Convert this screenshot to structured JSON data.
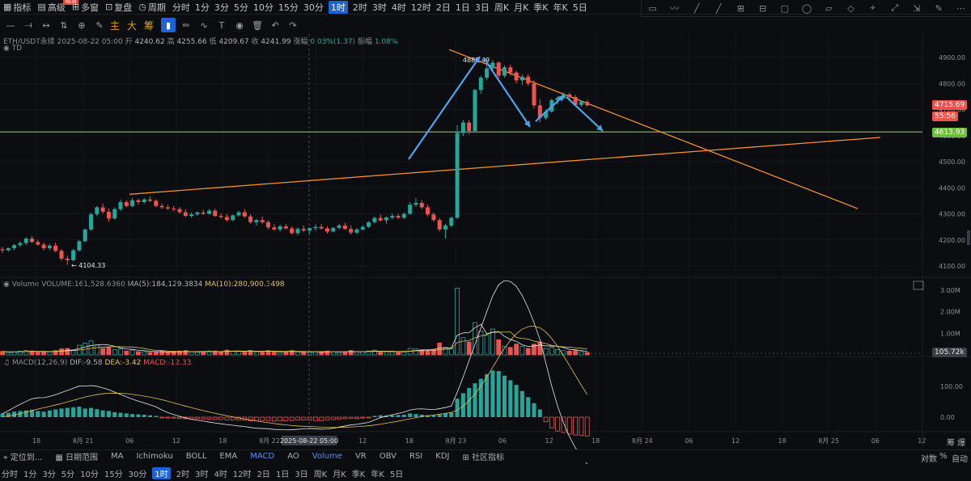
{
  "topbar": {
    "items": [
      {
        "icon": "indicator-icon",
        "label": "指标"
      },
      {
        "icon": "advanced-icon",
        "label": "高级"
      },
      {
        "icon": "multi-window-icon",
        "label": "多窗"
      },
      {
        "icon": "replay-icon",
        "label": "复盘"
      },
      {
        "icon": "period-icon",
        "label": "周期"
      }
    ],
    "badge": "NEW",
    "periods": [
      "分时",
      "1分",
      "3分",
      "5分",
      "10分",
      "15分",
      "30分",
      "1时",
      "2时",
      "3时",
      "4时",
      "12时",
      "2日",
      "1日",
      "3日",
      "周K",
      "月K",
      "季K",
      "年K",
      "5日"
    ],
    "active_period": "1时"
  },
  "toolbar": {
    "tools_left": [
      "minus",
      "line-h",
      "arrows",
      "sliders",
      "plus-box",
      "pen"
    ],
    "words": [
      "主",
      "大",
      "筹"
    ],
    "tools_right": [
      "bookmark",
      "pencil",
      "curve",
      "text",
      "eye",
      "trash",
      "undo",
      "redo"
    ]
  },
  "right_tools": [
    "▭",
    "〰",
    "╱",
    "╱",
    "⊞",
    "⊟",
    "▢",
    "◯",
    "▱",
    "◇",
    "⌖",
    "⤢",
    "⇲",
    "✎",
    "⋯"
  ],
  "header": {
    "symbol": "ETH/USDT永续",
    "time": "2025-08-22 05:00",
    "open_label": "开",
    "open": "4240.62",
    "high_label": "高",
    "high": "4255.66",
    "low_label": "低",
    "low": "4209.67",
    "close_label": "收",
    "close": "4241.99",
    "change_label": "涨幅",
    "change": "0.03%(1.37)",
    "amp_label": "振幅",
    "amp": "1.08%",
    "td": "TD"
  },
  "volume_info": {
    "label": "Volume",
    "vol": "VOLUME:161,528.6360",
    "ma5": "MA(5):184,129.3834",
    "ma10": "MA(10):280,900.3498"
  },
  "macd_info": {
    "label": "MACD(12,26,9)",
    "dif": "DIF:-9.58",
    "dea": "DEA:-3.42",
    "macd": "MACD:-12.33"
  },
  "colors": {
    "up": "#26a69a",
    "down": "#ef5350",
    "trend": "#f0922c",
    "support": "#6cbf3c",
    "arrow": "#4ea3f0"
  },
  "chart_data": {
    "type": "candlestick",
    "price_axis": {
      "ticks": [
        4100,
        4200,
        4300,
        4400,
        4500,
        4600,
        4700,
        4800,
        4900
      ],
      "labels": [
        "4100.00",
        "4200.00",
        "4300.00",
        "4400.00",
        "4500.00",
        "4600.00",
        "4700.00",
        "4800.00",
        "4900.00"
      ]
    },
    "volume_axis": {
      "labels": [
        "1.00M",
        "2.00M",
        "3.00M"
      ]
    },
    "macd_axis": {
      "labels": [
        "0.00",
        "100.00"
      ]
    },
    "time_axis": [
      "18",
      "8月 21",
      "06",
      "12",
      "18",
      "8月 22",
      "06",
      "12",
      "18",
      "8月 23",
      "06",
      "12",
      "18",
      "8月 24",
      "06",
      "12",
      "18",
      "8月 25",
      "06",
      "12"
    ],
    "crosshair_time": "2025-08-22 05:00",
    "annotations": {
      "high": "4888.49",
      "low": "4104.33"
    },
    "price_labels": {
      "last": "4715.69",
      "countdown": "55:56",
      "support": "4613.93",
      "volume": "105.72k"
    },
    "candles": [
      [
        4164,
        4173,
        4150,
        4160
      ],
      [
        4160,
        4170,
        4155,
        4168
      ],
      [
        4168,
        4185,
        4160,
        4180
      ],
      [
        4180,
        4195,
        4172,
        4188
      ],
      [
        4188,
        4210,
        4180,
        4205
      ],
      [
        4205,
        4215,
        4188,
        4192
      ],
      [
        4192,
        4200,
        4178,
        4182
      ],
      [
        4182,
        4190,
        4160,
        4168
      ],
      [
        4168,
        4185,
        4160,
        4178
      ],
      [
        4178,
        4190,
        4152,
        4158
      ],
      [
        4158,
        4165,
        4120,
        4128
      ],
      [
        4128,
        4140,
        4104,
        4122
      ],
      [
        4122,
        4165,
        4118,
        4160
      ],
      [
        4160,
        4200,
        4155,
        4195
      ],
      [
        4195,
        4245,
        4190,
        4240
      ],
      [
        4240,
        4305,
        4235,
        4298
      ],
      [
        4298,
        4330,
        4290,
        4325
      ],
      [
        4325,
        4340,
        4300,
        4308
      ],
      [
        4308,
        4320,
        4270,
        4282
      ],
      [
        4282,
        4325,
        4278,
        4318
      ],
      [
        4318,
        4355,
        4310,
        4345
      ],
      [
        4345,
        4352,
        4325,
        4330
      ],
      [
        4330,
        4362,
        4325,
        4352
      ],
      [
        4352,
        4358,
        4335,
        4345
      ],
      [
        4345,
        4360,
        4338,
        4355
      ],
      [
        4355,
        4368,
        4345,
        4350
      ],
      [
        4350,
        4356,
        4325,
        4330
      ],
      [
        4330,
        4340,
        4318,
        4325
      ],
      [
        4325,
        4335,
        4315,
        4320
      ],
      [
        4320,
        4330,
        4310,
        4318
      ],
      [
        4318,
        4326,
        4300,
        4306
      ],
      [
        4306,
        4318,
        4288,
        4292
      ],
      [
        4292,
        4306,
        4285,
        4298
      ],
      [
        4298,
        4310,
        4292,
        4305
      ],
      [
        4305,
        4316,
        4296,
        4300
      ],
      [
        4300,
        4318,
        4298,
        4312
      ],
      [
        4312,
        4320,
        4288,
        4292
      ],
      [
        4292,
        4302,
        4282,
        4288
      ],
      [
        4288,
        4300,
        4270,
        4276
      ],
      [
        4276,
        4298,
        4272,
        4294
      ],
      [
        4294,
        4312,
        4290,
        4306
      ],
      [
        4306,
        4318,
        4285,
        4290
      ],
      [
        4290,
        4298,
        4262,
        4268
      ],
      [
        4268,
        4282,
        4255,
        4276
      ],
      [
        4276,
        4290,
        4262,
        4268
      ],
      [
        4268,
        4275,
        4240,
        4248
      ],
      [
        4248,
        4260,
        4235,
        4240
      ],
      [
        4240,
        4258,
        4232,
        4252
      ],
      [
        4252,
        4262,
        4240,
        4244
      ],
      [
        4244,
        4252,
        4220,
        4226
      ],
      [
        4226,
        4248,
        4218,
        4242
      ],
      [
        4242,
        4255,
        4230,
        4236
      ],
      [
        4236,
        4248,
        4222,
        4245
      ],
      [
        4245,
        4260,
        4235,
        4250
      ],
      [
        4250,
        4262,
        4240,
        4244
      ],
      [
        4244,
        4252,
        4225,
        4232
      ],
      [
        4232,
        4250,
        4228,
        4246
      ],
      [
        4246,
        4262,
        4240,
        4255
      ],
      [
        4255,
        4266,
        4238,
        4242
      ],
      [
        4242,
        4256,
        4220,
        4228
      ],
      [
        4228,
        4246,
        4222,
        4240
      ],
      [
        4240,
        4255,
        4235,
        4250
      ],
      [
        4250,
        4272,
        4246,
        4268
      ],
      [
        4268,
        4290,
        4262,
        4284
      ],
      [
        4284,
        4298,
        4270,
        4275
      ],
      [
        4275,
        4290,
        4262,
        4286
      ],
      [
        4286,
        4302,
        4278,
        4292
      ],
      [
        4292,
        4300,
        4280,
        4285
      ],
      [
        4285,
        4305,
        4280,
        4300
      ],
      [
        4300,
        4345,
        4296,
        4335
      ],
      [
        4335,
        4360,
        4328,
        4342
      ],
      [
        4342,
        4352,
        4318,
        4325
      ],
      [
        4325,
        4335,
        4290,
        4298
      ],
      [
        4298,
        4306,
        4270,
        4276
      ],
      [
        4276,
        4284,
        4232,
        4240
      ],
      [
        4240,
        4262,
        4205,
        4255
      ],
      [
        4255,
        4290,
        4248,
        4285
      ],
      [
        4285,
        4640,
        4280,
        4610
      ],
      [
        4610,
        4660,
        4598,
        4650
      ],
      [
        4650,
        4660,
        4605,
        4618
      ],
      [
        4618,
        4780,
        4612,
        4775
      ],
      [
        4775,
        4830,
        4760,
        4822
      ],
      [
        4822,
        4870,
        4812,
        4858
      ],
      [
        4858,
        4890,
        4848,
        4880
      ],
      [
        4880,
        4886,
        4820,
        4830
      ],
      [
        4830,
        4870,
        4822,
        4862
      ],
      [
        4862,
        4872,
        4830,
        4842
      ],
      [
        4842,
        4848,
        4800,
        4812
      ],
      [
        4812,
        4836,
        4795,
        4826
      ],
      [
        4826,
        4836,
        4790,
        4800
      ],
      [
        4800,
        4812,
        4705,
        4716
      ],
      [
        4716,
        4740,
        4650,
        4668
      ],
      [
        4668,
        4700,
        4660,
        4692
      ],
      [
        4692,
        4742,
        4688,
        4736
      ],
      [
        4736,
        4752,
        4720,
        4745
      ],
      [
        4745,
        4765,
        4738,
        4758
      ],
      [
        4758,
        4765,
        4740,
        4748
      ],
      [
        4748,
        4756,
        4712,
        4718
      ],
      [
        4718,
        4736,
        4710,
        4730
      ],
      [
        4730,
        4736,
        4710,
        4716
      ]
    ],
    "volumes": [
      0.16,
      0.12,
      0.14,
      0.17,
      0.2,
      0.18,
      0.12,
      0.15,
      0.14,
      0.2,
      0.28,
      0.3,
      0.22,
      0.45,
      0.55,
      0.65,
      0.45,
      0.3,
      0.35,
      0.25,
      0.28,
      0.18,
      0.22,
      0.15,
      0.15,
      0.12,
      0.12,
      0.18,
      0.13,
      0.12,
      0.18,
      0.2,
      0.15,
      0.12,
      0.14,
      0.18,
      0.18,
      0.14,
      0.22,
      0.16,
      0.18,
      0.16,
      0.2,
      0.14,
      0.16,
      0.2,
      0.16,
      0.12,
      0.14,
      0.2,
      0.14,
      0.12,
      0.12,
      0.14,
      0.15,
      0.18,
      0.14,
      0.12,
      0.15,
      0.2,
      0.14,
      0.14,
      0.18,
      0.22,
      0.15,
      0.14,
      0.14,
      0.12,
      0.16,
      0.3,
      0.28,
      0.24,
      0.22,
      0.25,
      0.55,
      0.35,
      0.3,
      3.1,
      0.8,
      0.6,
      1.5,
      1.1,
      0.9,
      1.2,
      0.7,
      0.4,
      0.35,
      0.5,
      0.4,
      0.3,
      0.5,
      0.6,
      0.3,
      0.35,
      0.25,
      0.2,
      0.18,
      0.2,
      0.15,
      0.12
    ],
    "macd_hist": [
      12,
      14,
      18,
      20,
      22,
      24,
      20,
      18,
      22,
      25,
      28,
      30,
      32,
      34,
      28,
      30,
      26,
      22,
      20,
      16,
      14,
      12,
      10,
      9,
      8,
      6,
      4,
      -2,
      -3,
      -3,
      -4,
      -5,
      -6,
      -5,
      -6,
      -7,
      -8,
      -8,
      -9,
      -9,
      -10,
      -10,
      -12,
      -12,
      -11,
      -11,
      -13,
      -12,
      -12,
      -11,
      -10,
      -9,
      -10,
      -11,
      -12,
      -10,
      -8,
      -6,
      -5,
      -4,
      -5,
      -3,
      -2,
      4,
      6,
      5,
      6,
      7,
      8,
      12,
      10,
      8,
      6,
      6,
      10,
      12,
      14,
      60,
      78,
      95,
      110,
      125,
      140,
      152,
      150,
      135,
      120,
      105,
      85,
      65,
      45,
      25,
      -15,
      -35,
      -45,
      -50,
      -55,
      -58,
      -60,
      -62
    ]
  },
  "bottombar": {
    "items": [
      {
        "icon": "locate-icon",
        "label": "定位到..."
      },
      {
        "icon": "calendar-icon",
        "label": "日期范围"
      },
      {
        "label": "MA"
      },
      {
        "label": "Ichimoku"
      },
      {
        "label": "BOLL"
      },
      {
        "label": "EMA"
      },
      {
        "label": "MACD"
      },
      {
        "label": "AO"
      },
      {
        "label": "Volume"
      },
      {
        "label": "VR"
      },
      {
        "label": "OBV"
      },
      {
        "label": "RSI"
      },
      {
        "label": "KDJ"
      },
      {
        "icon": "community-icon",
        "label": "社区指标"
      }
    ],
    "active": [
      "MACD",
      "Volume"
    ],
    "right": {
      "log": "对数",
      "pct": "%",
      "auto": "自动"
    },
    "corner": "筹 爆"
  },
  "periodbar": {
    "items": [
      "分时",
      "1分",
      "3分",
      "5分",
      "10分",
      "15分",
      "30分",
      "1时",
      "2时",
      "3时",
      "4时",
      "12时",
      "2日",
      "1日",
      "3日",
      "周K",
      "月K",
      "季K",
      "年K",
      "5日"
    ],
    "active": "1时"
  }
}
